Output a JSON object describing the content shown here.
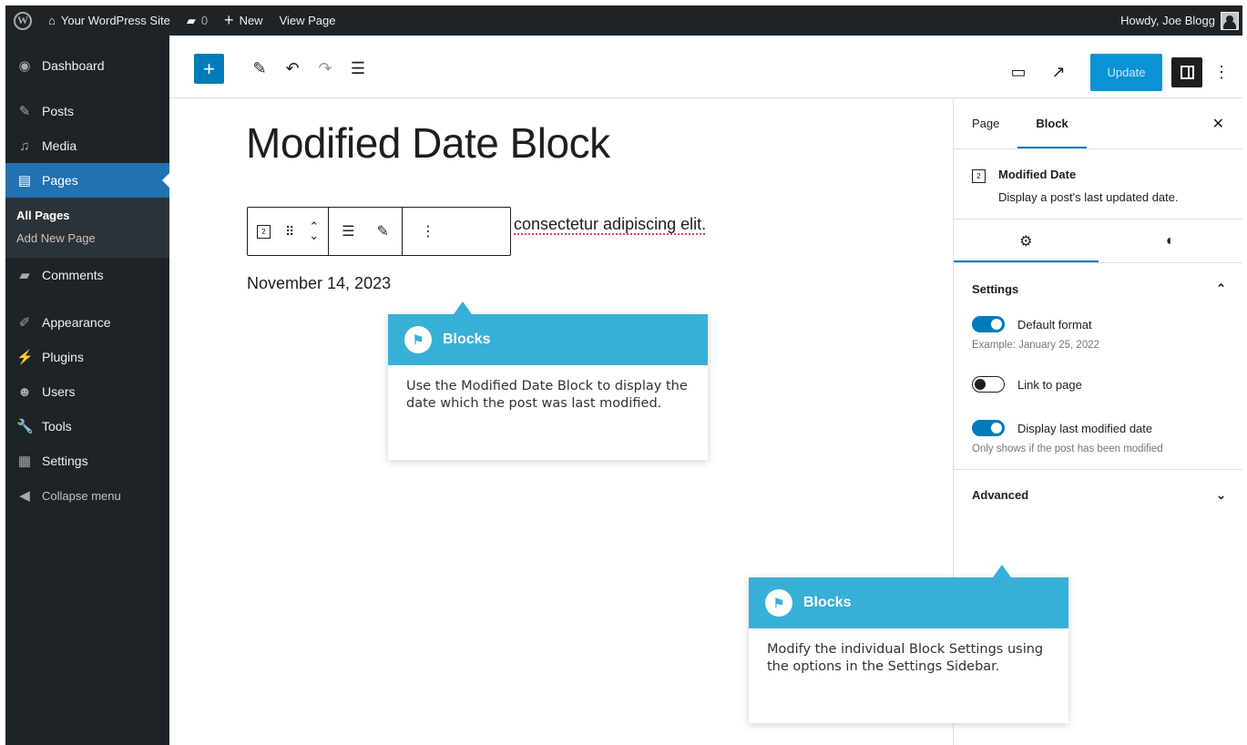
{
  "admin_bar": {
    "site_name": "Your WordPress Site",
    "comments_count": "0",
    "new_label": "New",
    "view_page_label": "View Page",
    "howdy": "Howdy, Joe Blogg"
  },
  "sidebar": {
    "items": [
      {
        "label": "Dashboard",
        "icon": "dashboard-icon"
      },
      {
        "label": "Posts",
        "icon": "pin-icon"
      },
      {
        "label": "Media",
        "icon": "media-icon"
      },
      {
        "label": "Pages",
        "icon": "pages-icon"
      },
      {
        "label": "Comments",
        "icon": "comment-icon"
      },
      {
        "label": "Appearance",
        "icon": "brush-icon"
      },
      {
        "label": "Plugins",
        "icon": "plugin-icon"
      },
      {
        "label": "Users",
        "icon": "users-icon"
      },
      {
        "label": "Tools",
        "icon": "wrench-icon"
      },
      {
        "label": "Settings",
        "icon": "settings-icon"
      },
      {
        "label": "Collapse menu",
        "icon": "collapse-icon"
      }
    ],
    "submenu": [
      "All Pages",
      "Add New Page"
    ]
  },
  "toolbar": {
    "update_label": "Update"
  },
  "canvas": {
    "title": "Modified Date Block",
    "paragraph_visible": "consectetur adipiscing elit.",
    "date": "November 14, 2023"
  },
  "callouts": [
    {
      "title": "Blocks",
      "body": "Use the Modified Date Block to display the date which the post was last modified."
    },
    {
      "title": "Blocks",
      "body": "Modify the individual Block Settings using the options in the Settings Sidebar."
    }
  ],
  "settings_sidebar": {
    "tab_page": "Page",
    "tab_block": "Block",
    "block_name": "Modified Date",
    "block_description": "Display a post's last updated date.",
    "calendar_day": "2",
    "panel_title": "Settings",
    "default_format_label": "Default format",
    "default_format_example": "Example: January 25, 2022",
    "link_label": "Link to page",
    "display_modified_label": "Display last modified date",
    "display_modified_help": "Only shows if the post has been modified",
    "advanced_label": "Advanced",
    "toggles": {
      "default_format": true,
      "link_to_page": false,
      "display_modified": true
    }
  },
  "colors": {
    "accent": "#007cba",
    "callout": "#37b0d8",
    "admin_dark": "#1d2327",
    "active_menu": "#2271b1"
  }
}
